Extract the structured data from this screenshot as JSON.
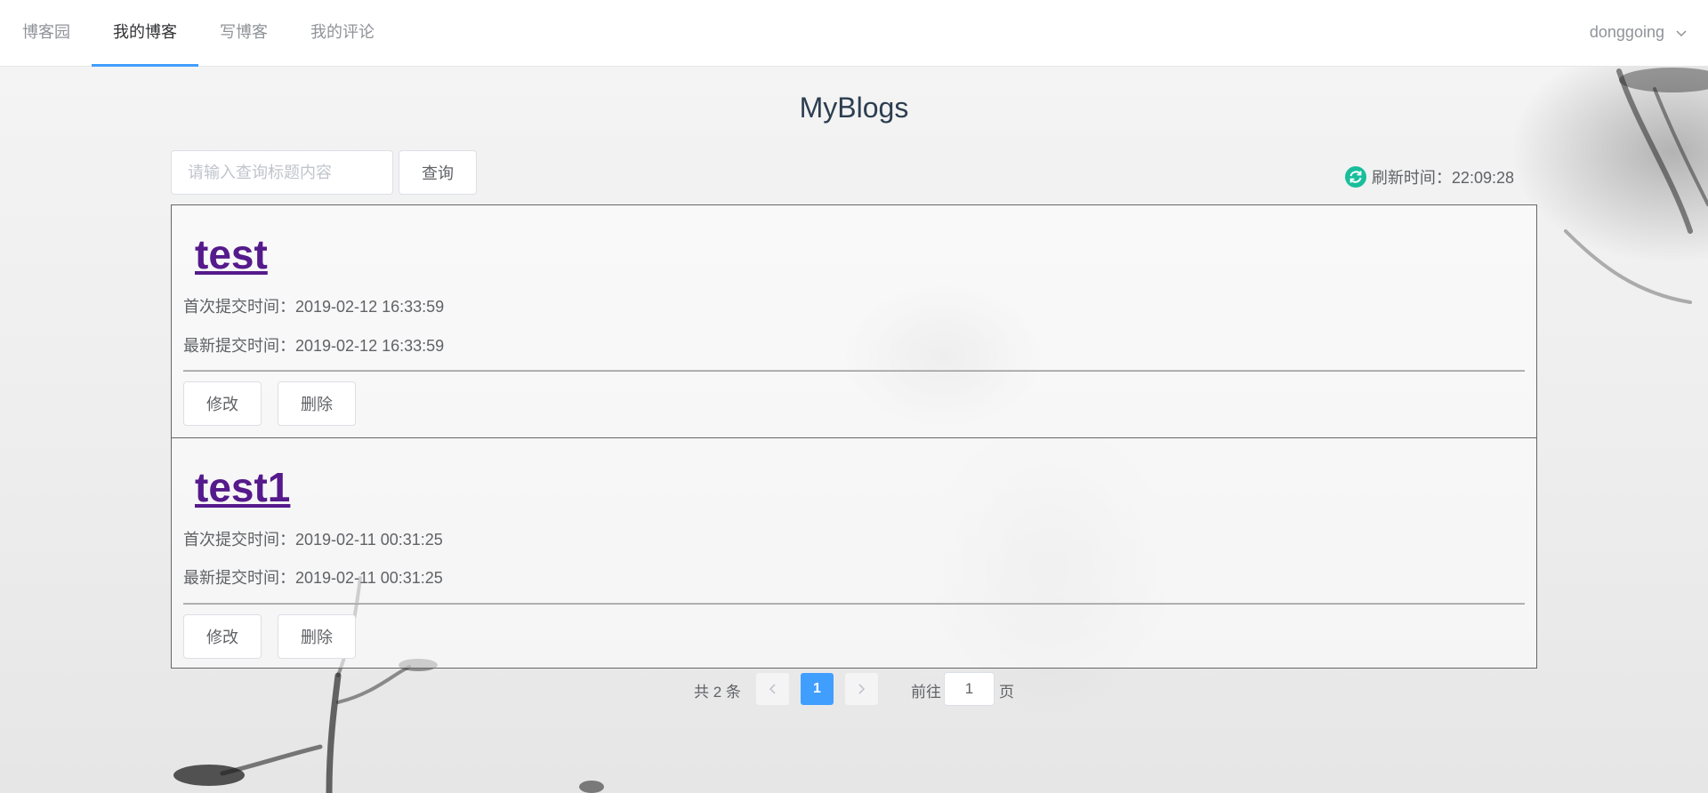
{
  "nav": {
    "items": [
      {
        "label": "博客园"
      },
      {
        "label": "我的博客"
      },
      {
        "label": "写博客"
      },
      {
        "label": "我的评论"
      }
    ],
    "active_index": 1,
    "user": {
      "name": "donggoing",
      "icon": "chevron-down-icon"
    }
  },
  "page": {
    "title": "MyBlogs"
  },
  "search": {
    "placeholder": "请输入查询标题内容",
    "value": "",
    "button_label": "查询"
  },
  "refresh": {
    "label": "刷新时间：22:09:28",
    "icon": "refresh-icon",
    "icon_color": "#19be9b"
  },
  "blogs": [
    {
      "title": "test",
      "first_submit": "首次提交时间：2019-02-12 16:33:59",
      "last_submit": "最新提交时间：2019-02-12 16:33:59",
      "edit_label": "修改",
      "delete_label": "删除"
    },
    {
      "title": "test1",
      "first_submit": "首次提交时间：2019-02-11 00:31:25",
      "last_submit": "最新提交时间：2019-02-11 00:31:25",
      "edit_label": "修改",
      "delete_label": "删除"
    }
  ],
  "pagination": {
    "total_label": "共 2 条",
    "prev_icon": "chevron-left-icon",
    "current_page": "1",
    "next_icon": "chevron-right-icon",
    "goto_label": "前往",
    "goto_value": "1",
    "page_unit": "页"
  },
  "colors": {
    "accent": "#409eff",
    "link": "#551a8b"
  }
}
